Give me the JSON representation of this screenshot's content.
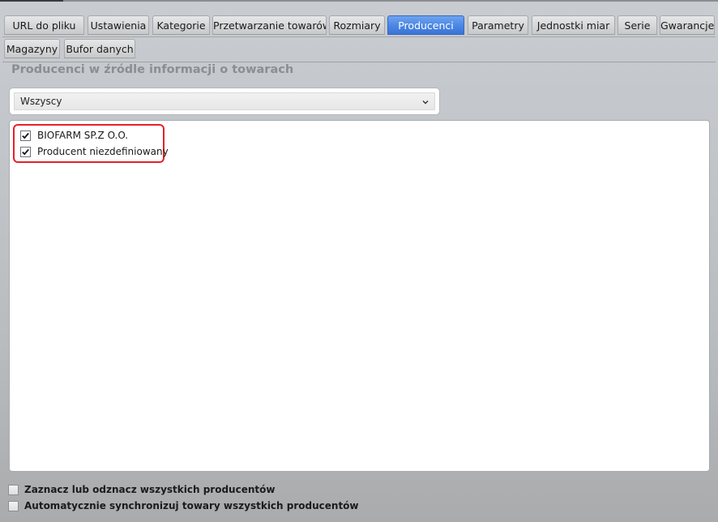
{
  "tabs": [
    {
      "label": "URL do pliku",
      "active": false
    },
    {
      "label": "Ustawienia",
      "active": false
    },
    {
      "label": "Kategorie",
      "active": false
    },
    {
      "label": "Przetwarzanie towarów",
      "active": false
    },
    {
      "label": "Rozmiary",
      "active": false
    },
    {
      "label": "Producenci",
      "active": true
    },
    {
      "label": "Parametry",
      "active": false
    },
    {
      "label": "Jednostki miar",
      "active": false
    },
    {
      "label": "Serie",
      "active": false
    },
    {
      "label": "Gwarancje",
      "active": false
    },
    {
      "label": "Magazyny",
      "active": false
    },
    {
      "label": "Bufor danych",
      "active": false
    }
  ],
  "section": {
    "title": "Producenci w źródle informacji o towarach"
  },
  "filter": {
    "selected": "Wszyscy"
  },
  "producers": [
    {
      "label": "BIOFARM SP.Z O.O.",
      "checked": true
    },
    {
      "label": "Producent niezdefiniowany",
      "checked": true
    }
  ],
  "options": {
    "select_all_label": "Zaznacz lub odznacz wszystkich producentów",
    "select_all_checked": false,
    "auto_sync_label": "Automatycznie synchronizuj towary wszystkich producentów",
    "auto_sync_checked": false
  },
  "colors": {
    "active_tab": "#4a86e3",
    "highlight_border": "#e8202a"
  },
  "icons": {
    "dropdown": "chevron-down-icon",
    "checkmark": "checkmark-icon"
  }
}
